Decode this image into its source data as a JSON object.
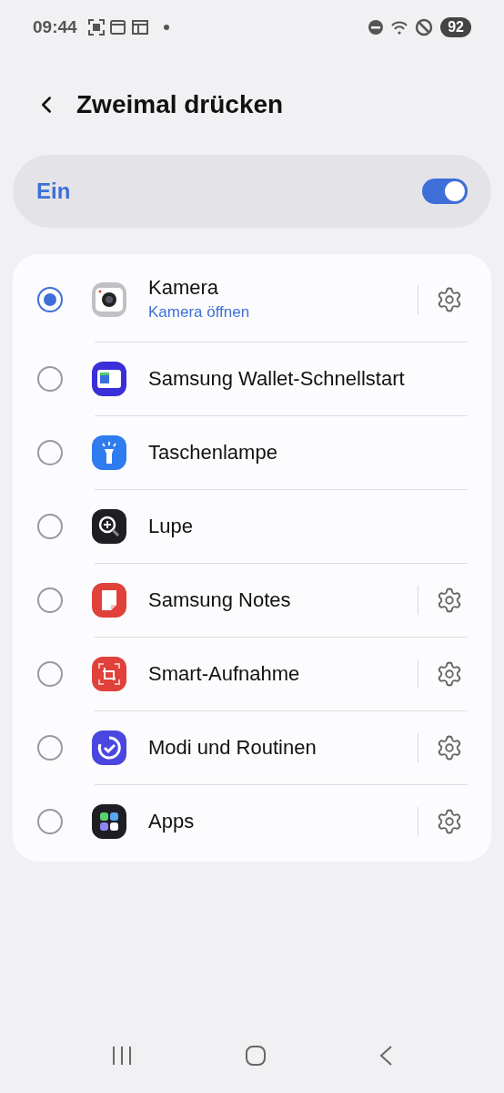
{
  "status_bar": {
    "time": "09:44",
    "battery": "92"
  },
  "header": {
    "title": "Zweimal drücken"
  },
  "master_switch": {
    "label": "Ein",
    "on": true
  },
  "options": [
    {
      "kind": "camera",
      "label": "Kamera",
      "subtitle": "Kamera öffnen",
      "selected": true,
      "settings": true
    },
    {
      "kind": "wallet",
      "label": "Samsung Wallet-Schnellstart",
      "selected": false,
      "settings": false
    },
    {
      "kind": "flashlight",
      "label": "Taschenlampe",
      "selected": false,
      "settings": false
    },
    {
      "kind": "magnifier",
      "label": "Lupe",
      "selected": false,
      "settings": false
    },
    {
      "kind": "notes",
      "label": "Samsung Notes",
      "selected": false,
      "settings": true
    },
    {
      "kind": "capture",
      "label": "Smart-Aufnahme",
      "selected": false,
      "settings": true
    },
    {
      "kind": "routines",
      "label": "Modi und Routinen",
      "selected": false,
      "settings": true
    },
    {
      "kind": "apps",
      "label": "Apps",
      "selected": false,
      "settings": true
    }
  ]
}
